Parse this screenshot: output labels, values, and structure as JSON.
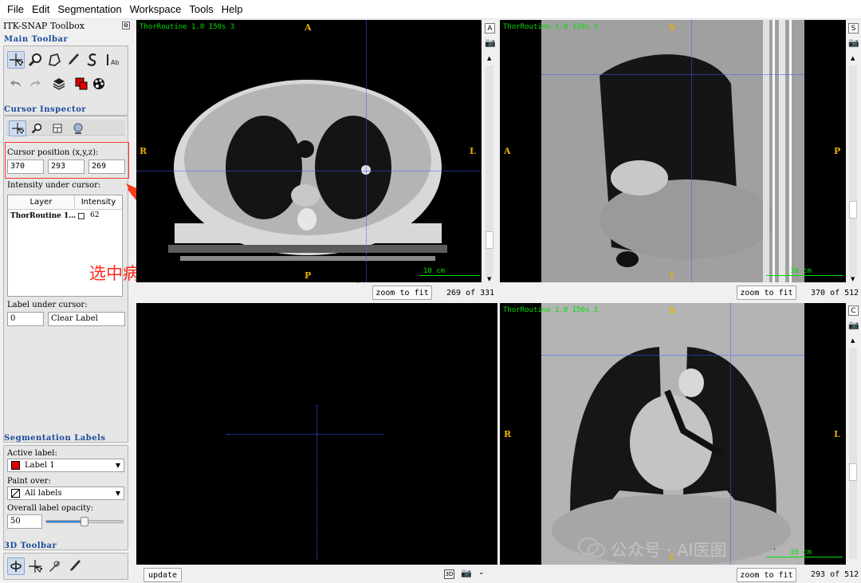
{
  "menu": [
    "File",
    "Edit",
    "Segmentation",
    "Workspace",
    "Tools",
    "Help"
  ],
  "toolbox": {
    "title": "ITK-SNAP Toolbox",
    "main_toolbar_title": "Main Toolbar",
    "cursor_inspector_title": "Cursor Inspector",
    "cursor_position_label": "Cursor position (x,y,z):",
    "cursor_x": "370",
    "cursor_y": "293",
    "cursor_z": "269",
    "intensity_label": "Intensity under cursor:",
    "table_headers": [
      "Layer",
      "Intensity"
    ],
    "table_row": {
      "layer": "ThorRoutine 1…",
      "intensity": "62"
    },
    "label_under_cursor_label": "Label under cursor:",
    "label_under_cursor_value": "0",
    "label_under_cursor_name": "Clear Label",
    "seg_labels_title": "Segmentation Labels",
    "active_label_label": "Active label:",
    "active_label_value": "Label 1",
    "paint_over_label": "Paint over:",
    "paint_over_value": "All labels",
    "opacity_label": "Overall label opacity:",
    "opacity_value": "50",
    "opacity_fraction": 0.5,
    "toolbar3d_title": "3D Toolbar"
  },
  "annotation": {
    "text": "选中病灶中心，记录中心点坐标（x,y,z)",
    "color": "#ff2a1a"
  },
  "views": {
    "axial": {
      "info": "ThorRoutine  1.0  I50s  3",
      "top": "A",
      "left": "R",
      "right": "L",
      "bottom": "P",
      "scale": "10 cm",
      "zoom_fit": "zoom to fit",
      "slice": "269 of 331"
    },
    "sagittal": {
      "info": "ThorRoutine  1.0  I50s  3",
      "top": "S",
      "left": "A",
      "right": "P",
      "bottom": "I",
      "scale": "10 cm",
      "zoom_fit": "zoom to fit",
      "slice": "370 of 512"
    },
    "three_d": {
      "update_label": "update"
    },
    "coronal": {
      "info": "ThorRoutine  1.0  I50s  3",
      "top": "S",
      "left": "R",
      "right": "L",
      "bottom": "I",
      "scale": "10 cm",
      "zoom_fit": "zoom to fit",
      "slice": "293 of 512"
    }
  },
  "watermark": "公众号 · AI医图",
  "colors": {
    "crosshair": "#3a5cff",
    "overlay_text": "#00e000",
    "orientation": "#e8b000",
    "section_title": "#1a4a9a",
    "active_label_swatch": "#e00000"
  }
}
